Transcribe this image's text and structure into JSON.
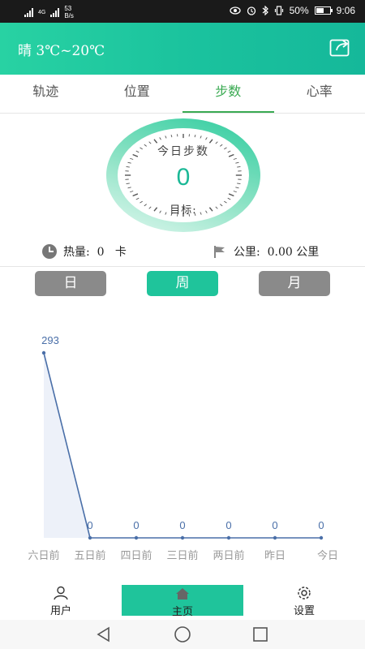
{
  "status_bar": {
    "network": "4G",
    "net_speed": "53",
    "net_unit": "B/s",
    "battery": "50%",
    "battery_level": 0.5,
    "time": "9:06"
  },
  "header": {
    "weather": "晴  3℃~20℃",
    "share_icon": "share-icon",
    "color": "#1bc39e"
  },
  "tabs": [
    {
      "label": "轨迹"
    },
    {
      "label": "位置"
    },
    {
      "label": "步数",
      "active": true
    },
    {
      "label": "心率"
    }
  ],
  "dial": {
    "title": "今日步数",
    "value": "0",
    "goal_label": "目标:"
  },
  "stats": {
    "calories": "热量:  0   卡",
    "distance": "公里:  0.00 公里"
  },
  "period_buttons": {
    "day": "日",
    "week": "周",
    "month": "月",
    "selected": "week"
  },
  "chart_data": {
    "type": "line",
    "categories": [
      "六日前",
      "五日前",
      "四日前",
      "三日前",
      "两日前",
      "昨日",
      "今日"
    ],
    "values": [
      293,
      0,
      0,
      0,
      0,
      0,
      0
    ],
    "ylim": [
      0,
      293
    ],
    "grid": false,
    "line_color": "#4a6fa8"
  },
  "bottom_nav": {
    "user": "用户",
    "home": "主页",
    "settings": "设置",
    "active": "home"
  }
}
